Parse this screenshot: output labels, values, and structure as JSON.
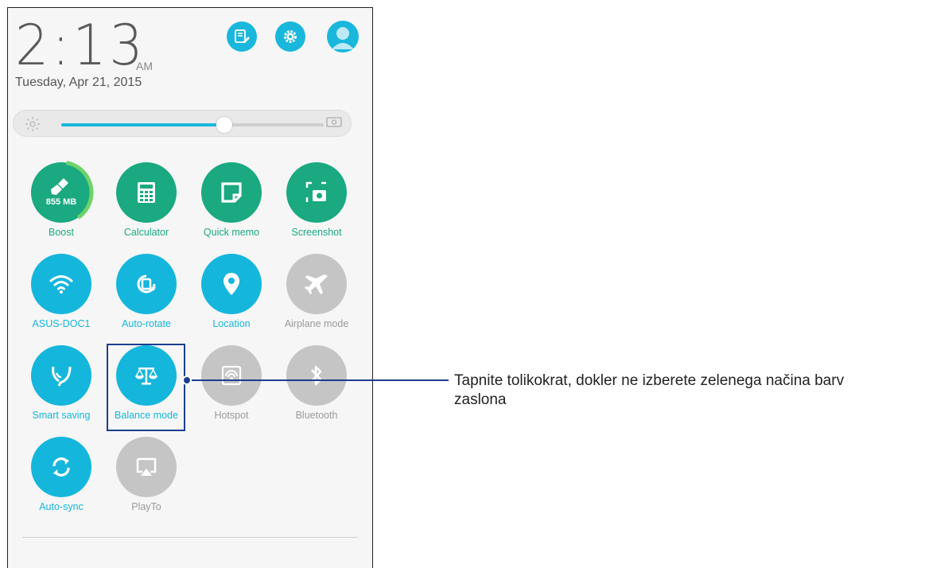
{
  "status": {
    "time": "2:13",
    "ampm": "AM",
    "date": "Tuesday, Apr 21, 2015"
  },
  "top_actions": [
    {
      "name": "edit-notes-icon"
    },
    {
      "name": "settings-gear-icon"
    },
    {
      "name": "user-avatar-icon"
    }
  ],
  "brightness": {
    "level": 0.62,
    "auto_label": "AUTO"
  },
  "tiles": [
    {
      "label": "Boost",
      "state": "green",
      "icon": "broom-icon",
      "badge": "855 MB"
    },
    {
      "label": "Calculator",
      "state": "green",
      "icon": "calculator-icon"
    },
    {
      "label": "Quick memo",
      "state": "green",
      "icon": "memo-icon"
    },
    {
      "label": "Screenshot",
      "state": "green",
      "icon": "screenshot-icon"
    },
    {
      "label": "ASUS-DOC1",
      "state": "blue",
      "icon": "wifi-icon"
    },
    {
      "label": "Auto-rotate",
      "state": "blue",
      "icon": "rotate-icon"
    },
    {
      "label": "Location",
      "state": "blue",
      "icon": "location-pin-icon"
    },
    {
      "label": "Airplane mode",
      "state": "gray",
      "icon": "airplane-icon"
    },
    {
      "label": "Smart saving",
      "state": "blue",
      "icon": "leaf-icon"
    },
    {
      "label": "Balance mode",
      "state": "blue",
      "icon": "balance-scale-icon"
    },
    {
      "label": "Hotspot",
      "state": "gray",
      "icon": "hotspot-icon"
    },
    {
      "label": "Bluetooth",
      "state": "gray",
      "icon": "bluetooth-icon"
    },
    {
      "label": "Auto-sync",
      "state": "blue",
      "icon": "sync-icon"
    },
    {
      "label": "PlayTo",
      "state": "gray",
      "icon": "playto-icon"
    }
  ],
  "callout": {
    "text": "Tapnite tolikokrat, dokler ne izberete zelenega načina barv zaslona",
    "line1": "Tapnite tolikokrat, dokler ne izberete zelenega načina barv",
    "line2": "zaslona"
  },
  "colors": {
    "green": "#1aa980",
    "blue": "#15b6dc",
    "gray": "#c5c5c5",
    "highlight": "#1b3f8f"
  }
}
